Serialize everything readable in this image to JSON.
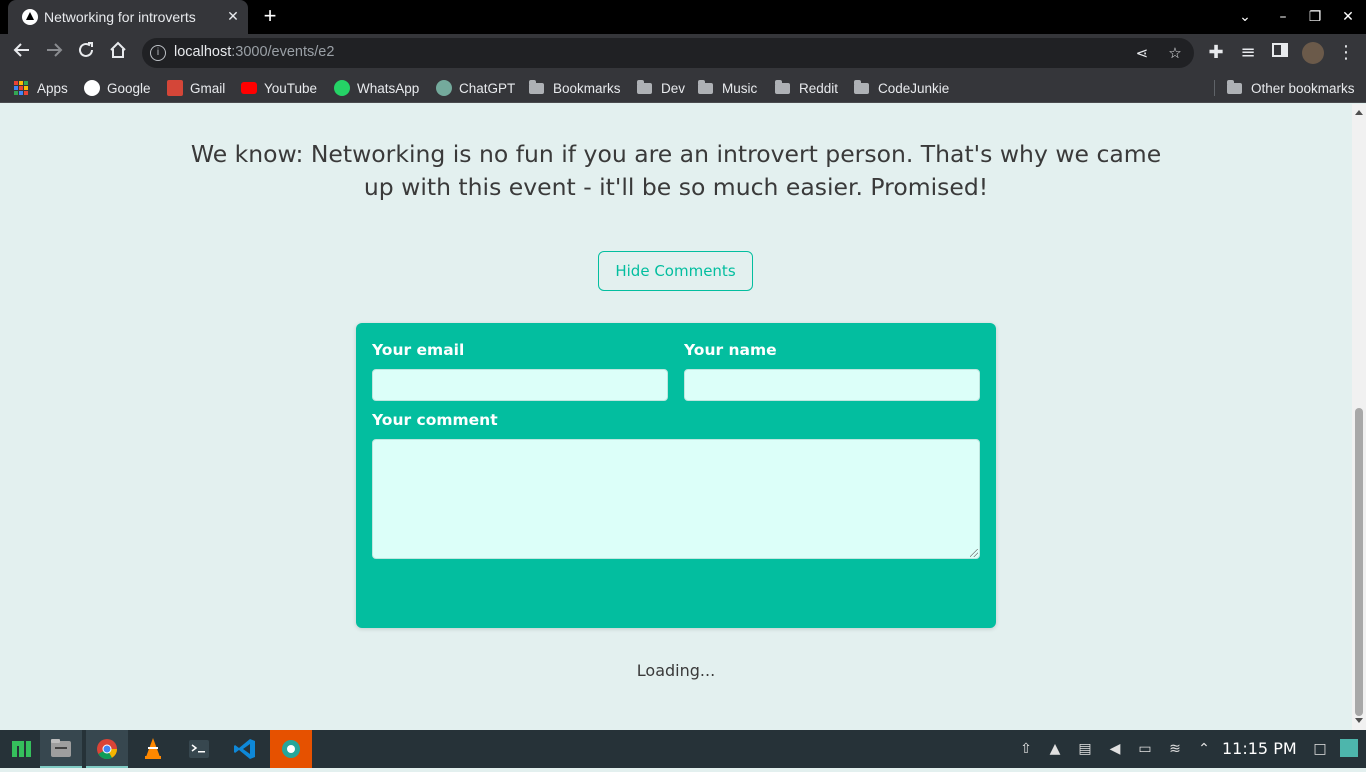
{
  "browser": {
    "tab_title": "Networking for introverts",
    "tab_close": "✕",
    "new_tab": "+",
    "url_host": "localhost",
    "url_path": ":3000/events/e2"
  },
  "bookmarks": [
    {
      "label": "Apps"
    },
    {
      "label": "Google"
    },
    {
      "label": "Gmail"
    },
    {
      "label": "YouTube"
    },
    {
      "label": "WhatsApp"
    },
    {
      "label": "ChatGPT"
    },
    {
      "label": "Bookmarks"
    },
    {
      "label": "Dev"
    },
    {
      "label": "Music"
    },
    {
      "label": "Reddit"
    },
    {
      "label": "CodeJunkie"
    }
  ],
  "other_bookmarks": "Other bookmarks",
  "page": {
    "intro": "We know: Networking is no fun if you are an introvert person. That's why we came up with this event - it'll be so much easier. Promised!",
    "toggle_comments": "Hide Comments",
    "form": {
      "email_label": "Your email",
      "email_value": "",
      "name_label": "Your name",
      "name_value": "",
      "comment_label": "Your comment",
      "comment_value": ""
    },
    "loading": "Loading..."
  },
  "colors": {
    "accent": "#03be9f",
    "page_bg": "#e3f0ef",
    "field_bg": "#dcfff9",
    "browser_chrome": "#35363a",
    "taskbar": "#263238"
  },
  "taskbar": {
    "apps": [
      "start-menu-icon",
      "files-icon",
      "chrome-icon",
      "vlc-icon",
      "terminal-icon",
      "vscode-icon",
      "screenshot-icon"
    ],
    "clock": "11:15 PM"
  }
}
